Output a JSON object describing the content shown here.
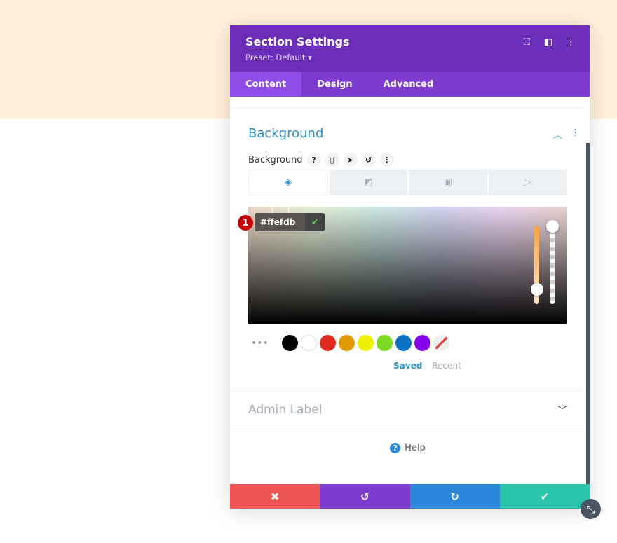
{
  "page": {
    "top_band_color": "#ffefdb"
  },
  "modal": {
    "title": "Section Settings",
    "preset": "Preset: Default ▾",
    "header_icons": [
      "focus-icon",
      "sidebar-layout-icon",
      "more-vertical-icon"
    ],
    "tabs": [
      {
        "label": "Content",
        "active": true
      },
      {
        "label": "Design"
      },
      {
        "label": "Advanced"
      }
    ],
    "background_section": {
      "title": "Background",
      "field_label": "Background",
      "field_icons": [
        "help-icon",
        "mobile-icon",
        "cursor-icon",
        "reset-icon",
        "more-icon"
      ],
      "type_tabs": [
        "color-fill-icon",
        "gradient-icon",
        "image-icon",
        "video-icon"
      ],
      "color_picker": {
        "hex_value": "#ffefdb",
        "annotation_badge": "1",
        "hue_level": 0.08,
        "alpha_level": 1.0
      },
      "swatches": [
        "#000000",
        "#ffffff",
        "#e02b20",
        "#e09900",
        "#edf000",
        "#7cda24",
        "#0c71c3",
        "#8300e9",
        "none"
      ],
      "palette_tabs": {
        "saved": "Saved",
        "recent": "Recent"
      }
    },
    "admin_label": "Admin Label",
    "help": "Help",
    "bottom_buttons": [
      {
        "name": "cancel",
        "icon": "✖",
        "color": "#ef5555"
      },
      {
        "name": "undo",
        "icon": "↺",
        "color": "#7e3bd0"
      },
      {
        "name": "redo",
        "icon": "↻",
        "color": "#2b87da"
      },
      {
        "name": "save",
        "icon": "✔",
        "color": "#29c4a9"
      }
    ]
  }
}
